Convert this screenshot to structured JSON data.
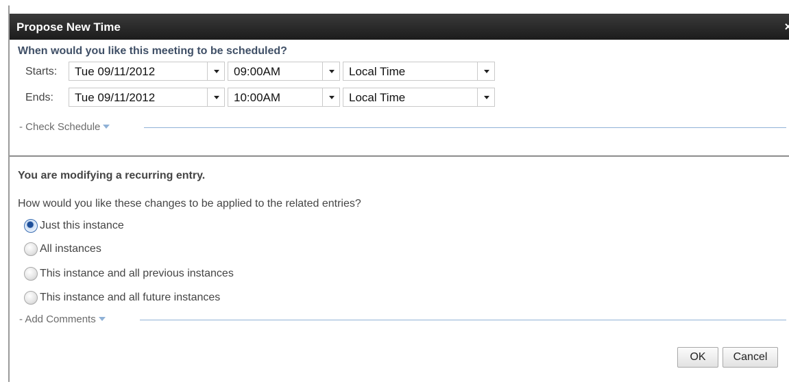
{
  "dialog": {
    "title": "Propose New Time",
    "close_label": "×"
  },
  "schedule": {
    "question": "When would you like this meeting to be scheduled?",
    "starts": {
      "label": "Starts:",
      "date": "Tue 09/11/2012",
      "time": "09:00AM",
      "timezone": "Local Time"
    },
    "ends": {
      "label": "Ends:",
      "date": "Tue 09/11/2012",
      "time": "10:00AM",
      "timezone": "Local Time"
    },
    "check_schedule_label": "- Check Schedule"
  },
  "recurring": {
    "title": "You are modifying a recurring entry.",
    "question": "How would you like these changes to be applied to the related entries?",
    "options": [
      {
        "label": "Just this instance",
        "selected": true
      },
      {
        "label": "All instances",
        "selected": false
      },
      {
        "label": "This instance and all previous instances",
        "selected": false
      },
      {
        "label": "This instance and all future instances",
        "selected": false
      }
    ],
    "add_comments_label": "- Add Comments"
  },
  "buttons": {
    "ok": "OK",
    "cancel": "Cancel"
  },
  "colors": {
    "titlebar": "#1c1c1c",
    "question_text": "#3f4f66",
    "rule": "#8fb1d6",
    "radio_selected": "#1d4f9a"
  }
}
